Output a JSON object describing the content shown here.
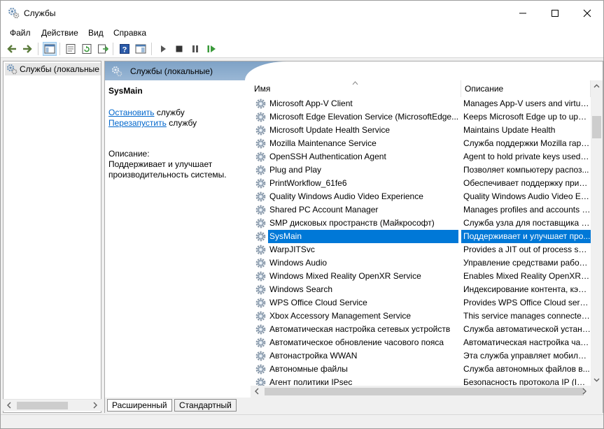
{
  "window": {
    "title": "Службы",
    "icon": "gear-icon"
  },
  "menu": [
    "Файл",
    "Действие",
    "Вид",
    "Справка"
  ],
  "tree": {
    "item_label": "Службы (локальные"
  },
  "header": {
    "title": "Службы (локальные)"
  },
  "details": {
    "service_name": "SysMain",
    "stop_link": "Остановить",
    "stop_suffix": " службу",
    "restart_link": "Перезапустить",
    "restart_suffix": " службу",
    "desc_label": "Описание:",
    "desc_text": "Поддерживает и улучшает производительность системы."
  },
  "list": {
    "columns": [
      "Имя",
      "Описание"
    ],
    "selected_index": 10,
    "rows": [
      {
        "name": "Microsoft App-V Client",
        "desc": "Manages App-V users and virtual ..."
      },
      {
        "name": "Microsoft Edge Elevation Service (MicrosoftEdge...",
        "desc": "Keeps Microsoft Edge up to upda..."
      },
      {
        "name": "Microsoft Update Health Service",
        "desc": "Maintains Update Health"
      },
      {
        "name": "Mozilla Maintenance Service",
        "desc": "Служба поддержки Mozilla гара..."
      },
      {
        "name": "OpenSSH Authentication Agent",
        "desc": "Agent to hold private keys used f..."
      },
      {
        "name": "Plug and Play",
        "desc": "Позволяет компьютеру распоз..."
      },
      {
        "name": "PrintWorkflow_61fe6",
        "desc": "Обеспечивает поддержку прил..."
      },
      {
        "name": "Quality Windows Audio Video Experience",
        "desc": "Quality Windows Audio Video Ex..."
      },
      {
        "name": "Shared PC Account Manager",
        "desc": "Manages profiles and accounts o..."
      },
      {
        "name": "SMP дисковых пространств (Майкрософт)",
        "desc": "Служба узла для поставщика у..."
      },
      {
        "name": "SysMain",
        "desc": "Поддерживает и улучшает про..."
      },
      {
        "name": "WarpJITSvc",
        "desc": "Provides a JIT out of process servi..."
      },
      {
        "name": "Windows Audio",
        "desc": "Управление средствами работы..."
      },
      {
        "name": "Windows Mixed Reality OpenXR Service",
        "desc": "Enables Mixed Reality OpenXR ru..."
      },
      {
        "name": "Windows Search",
        "desc": "Индексирование контента, кэш..."
      },
      {
        "name": "WPS Office Cloud Service",
        "desc": "Provides WPS Office Cloud servic..."
      },
      {
        "name": "Xbox Accessory Management Service",
        "desc": "This service manages connected ..."
      },
      {
        "name": "Автоматическая настройка сетевых устройств",
        "desc": "Служба автоматической устано..."
      },
      {
        "name": "Автоматическое обновление часового пояса",
        "desc": "Автоматическая настройка час..."
      },
      {
        "name": "Автонастройка WWAN",
        "desc": "Эта служба управляет мобильн..."
      },
      {
        "name": "Автономные файлы",
        "desc": "Служба автономных файлов в..."
      },
      {
        "name": "Агент политики IPsec",
        "desc": "Безопасность протокола IP (IPs..."
      }
    ]
  },
  "tabs": [
    "Расширенный",
    "Стандартный"
  ],
  "colors": {
    "selection": "#0078d7",
    "link": "#0066cc",
    "header_gradient_start": "#7ea2c6"
  }
}
